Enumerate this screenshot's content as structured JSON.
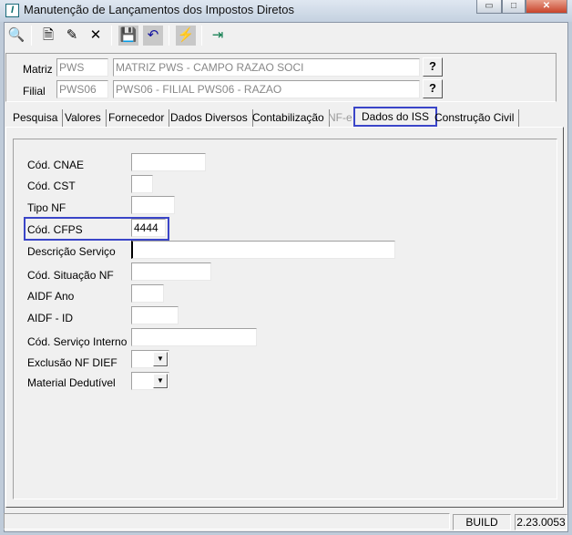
{
  "window": {
    "title": "Manutenção de Lançamentos dos Impostos Diretos",
    "icon_letter": "I",
    "minimize": "▭",
    "maximize": "□",
    "close": "✕"
  },
  "toolbar": [
    {
      "name": "search-icon",
      "glyph": "🔍"
    },
    {
      "name": "new-document-icon",
      "glyph": "🗎"
    },
    {
      "name": "edit-icon",
      "glyph": "✎"
    },
    {
      "name": "delete-icon",
      "glyph": "✕"
    },
    {
      "name": "save-icon",
      "glyph": "💾"
    },
    {
      "name": "undo-icon",
      "glyph": "↶"
    },
    {
      "name": "filter-icon",
      "glyph": "⚡"
    },
    {
      "name": "exit-icon",
      "glyph": "⇥"
    }
  ],
  "header": {
    "matriz": {
      "label": "Matriz",
      "code": "PWS",
      "description": "MATRIZ PWS -  CAMPO RAZAO SOCI",
      "lookup": "?"
    },
    "filial": {
      "label": "Filial",
      "code": "PWS06",
      "description": "PWS06 - FILIAL PWS06  - RAZAO",
      "lookup": "?"
    }
  },
  "tabs": [
    "Pesquisa",
    "Valores",
    "Fornecedor",
    "Dados Diversos",
    "Contabilização",
    "NF-e",
    "Dados do ISS",
    "Construção Civil"
  ],
  "active_tab": "Dados do ISS",
  "highlight_color": "#3a45c8",
  "form": {
    "cnae": {
      "label": "Cód. CNAE",
      "value": ""
    },
    "cst": {
      "label": "Cód. CST",
      "value": ""
    },
    "tipo_nf": {
      "label": "Tipo NF",
      "value": ""
    },
    "cfps": {
      "label": "Cód. CFPS",
      "value": "4444"
    },
    "descricao": {
      "label": "Descrição Serviço",
      "value": ""
    },
    "situacao": {
      "label": "Cód. Situação NF",
      "value": ""
    },
    "aidf_ano": {
      "label": "AIDF Ano",
      "value": ""
    },
    "aidf_id": {
      "label": "AIDF - ID",
      "value": ""
    },
    "servico_interno": {
      "label": "Cód. Serviço Interno",
      "value": ""
    },
    "exclusao": {
      "label": "Exclusão NF DIEF",
      "value": ""
    },
    "material": {
      "label": "Material Dedutível",
      "value": ""
    }
  },
  "statusbar": {
    "message": "",
    "build_label": "BUILD",
    "version": "2.23.0053"
  }
}
